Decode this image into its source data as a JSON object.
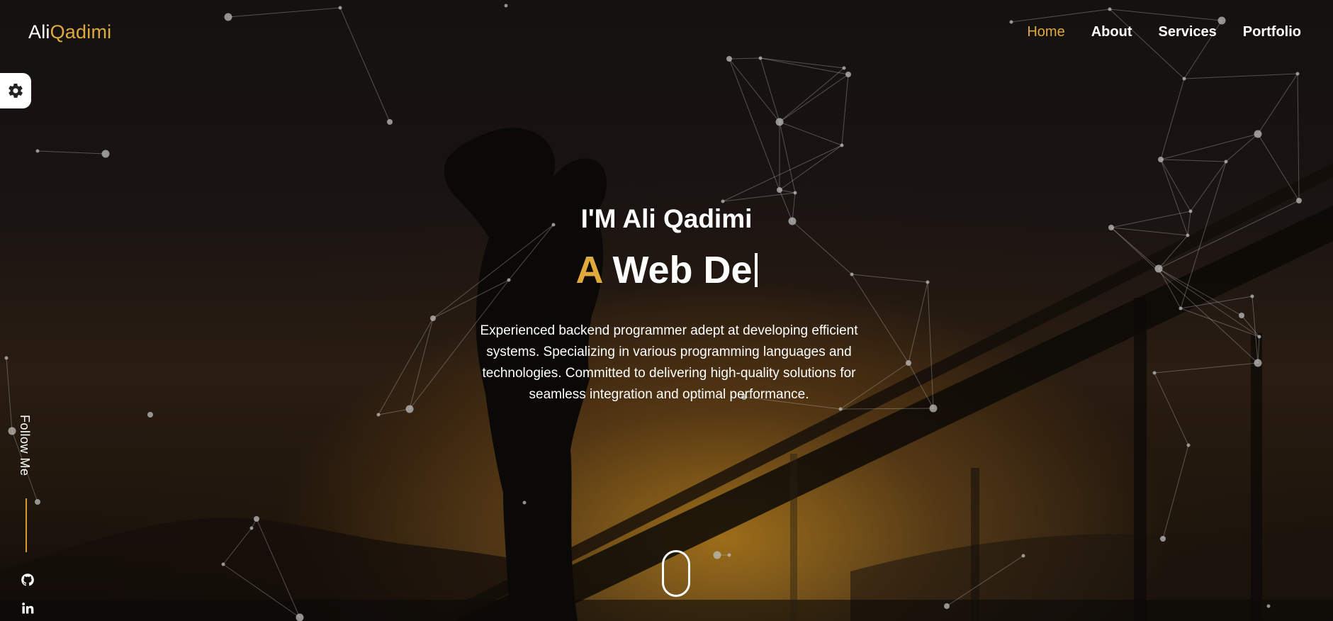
{
  "brand": {
    "first": "Ali",
    "second": "Qadimi"
  },
  "nav": {
    "items": [
      {
        "label": "Home",
        "active": true
      },
      {
        "label": "About",
        "active": false
      },
      {
        "label": "Services",
        "active": false
      },
      {
        "label": "Portfolio",
        "active": false
      }
    ]
  },
  "settings": {
    "icon": "gear-icon"
  },
  "hero": {
    "name": "I'M Ali Qadimi",
    "role_prefix": "A",
    "role_typed": "Web De",
    "description": "Experienced backend programmer adept at developing efficient systems. Specializing in various programming languages and technologies. Committed to delivering high-quality solutions for seamless integration and optimal performance."
  },
  "social": {
    "follow_label": "Follow Me",
    "links": [
      {
        "icon": "github-icon"
      },
      {
        "icon": "linkedin-icon"
      }
    ]
  },
  "scroll": {
    "icon": "scroll-mouse-icon"
  },
  "colors": {
    "accent": "#e0a93e",
    "text": "#ffffff",
    "background": "#141110"
  }
}
